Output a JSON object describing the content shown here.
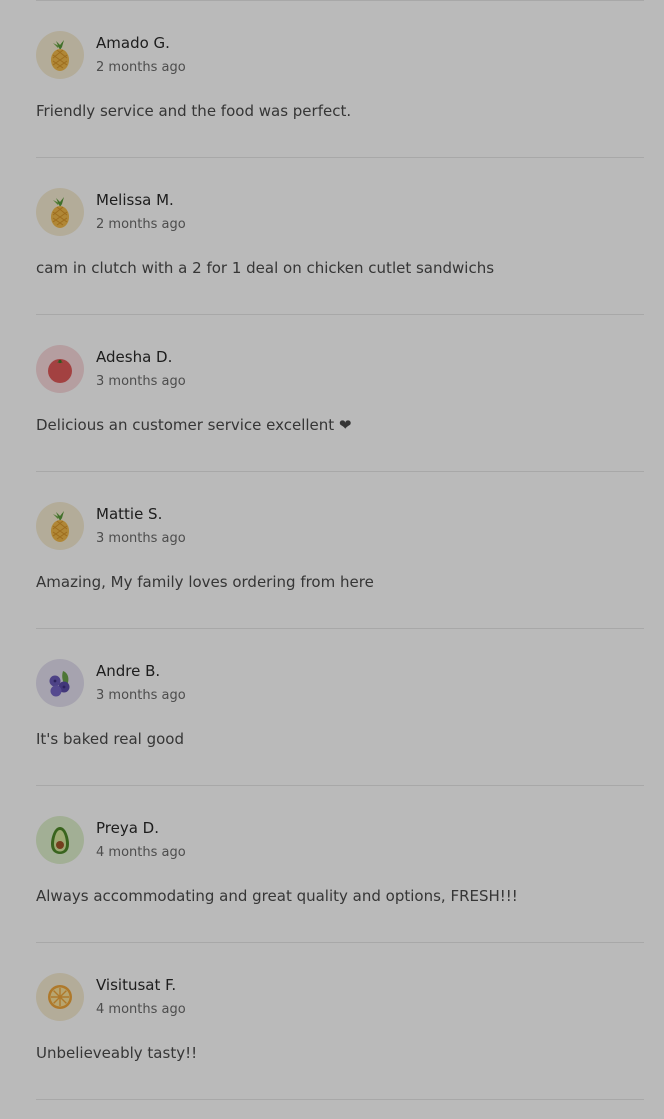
{
  "reviews": [
    {
      "name": "Amado G.",
      "time": "2 months ago",
      "text": "Friendly service and the food was perfect.",
      "avatar_icon": "pineapple-icon"
    },
    {
      "name": "Melissa M.",
      "time": "2 months ago",
      "text": "cam in clutch with a 2 for 1 deal on chicken cutlet sandwichs",
      "avatar_icon": "pineapple-icon"
    },
    {
      "name": "Adesha D.",
      "time": "3 months ago",
      "text": "Delicious an customer service excellent ❤",
      "avatar_icon": "tomato-icon"
    },
    {
      "name": "Mattie S.",
      "time": "3 months ago",
      "text": "Amazing, My family loves ordering from here",
      "avatar_icon": "pineapple-icon"
    },
    {
      "name": "Andre B.",
      "time": "3 months ago",
      "text": "It's baked real good",
      "avatar_icon": "blueberries-icon"
    },
    {
      "name": "Preya D.",
      "time": "4 months ago",
      "text": "Always accommodating and great quality and options, FRESH!!!",
      "avatar_icon": "avocado-icon"
    },
    {
      "name": "Visitusat F.",
      "time": "4 months ago",
      "text": "Unbelieveably tasty!!",
      "avatar_icon": "citrus-slice-icon"
    }
  ]
}
